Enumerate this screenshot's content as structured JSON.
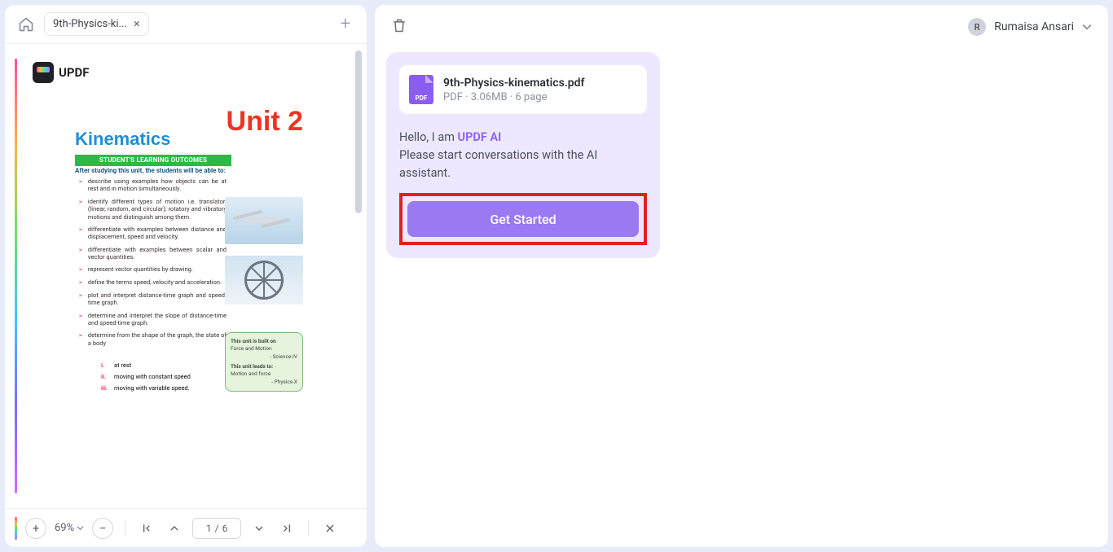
{
  "tab": {
    "label": "9th-Physics-ki...",
    "home_aria": "Home"
  },
  "document": {
    "logo": "UPDF",
    "unit": "Unit 2",
    "subject": "Kinematics",
    "outcomes_header": "STUDENT'S LEARNING OUTCOMES",
    "intro": "After studying this unit, the students will be able to:",
    "outcomes": [
      "describe using examples how objects can be at rest and in motion simultaneously.",
      "identify different types of motion i.e. translator; (linear, random, and circular); rotatory and vibratory motions and distinguish among them.",
      "differentiate with examples between distance and displacement, speed and velocity.",
      "differentiate with examples between scalar and vector quantities.",
      "represent vector quantities by drawing.",
      "define the terms speed, velocity and acceleration.",
      "plot and interpret distance-time graph and speed-time graph.",
      "determine and interpret the slope of distance-time and speed-time graph.",
      "determine from the shape of the graph, the state of a body"
    ],
    "sub_outcomes": [
      {
        "num": "i.",
        "text": "at rest"
      },
      {
        "num": "ii.",
        "text": "moving with constant speed"
      },
      {
        "num": "iii.",
        "text": "moving with variable speed."
      }
    ],
    "info_box": {
      "l1": "This unit is built on",
      "l2": "Force and Motion",
      "r1": "- Science-IV",
      "l3": "This unit leads to:",
      "l4": "Motion and force",
      "r2": "- Physics-X"
    }
  },
  "footer": {
    "zoom": "69%",
    "page_current": "1",
    "page_sep": "/",
    "page_total": "6"
  },
  "ai": {
    "file_name": "9th-Physics-kinematics.pdf",
    "file_sub": "PDF · 3.06MB · 6 page",
    "greet_prefix": "Hello, I am ",
    "greet_brand": "UPDF AI",
    "greet_line2": "Please start conversations with the AI assistant.",
    "cta": "Get Started"
  },
  "user": {
    "initial": "R",
    "name": "Rumaisa Ansari"
  }
}
